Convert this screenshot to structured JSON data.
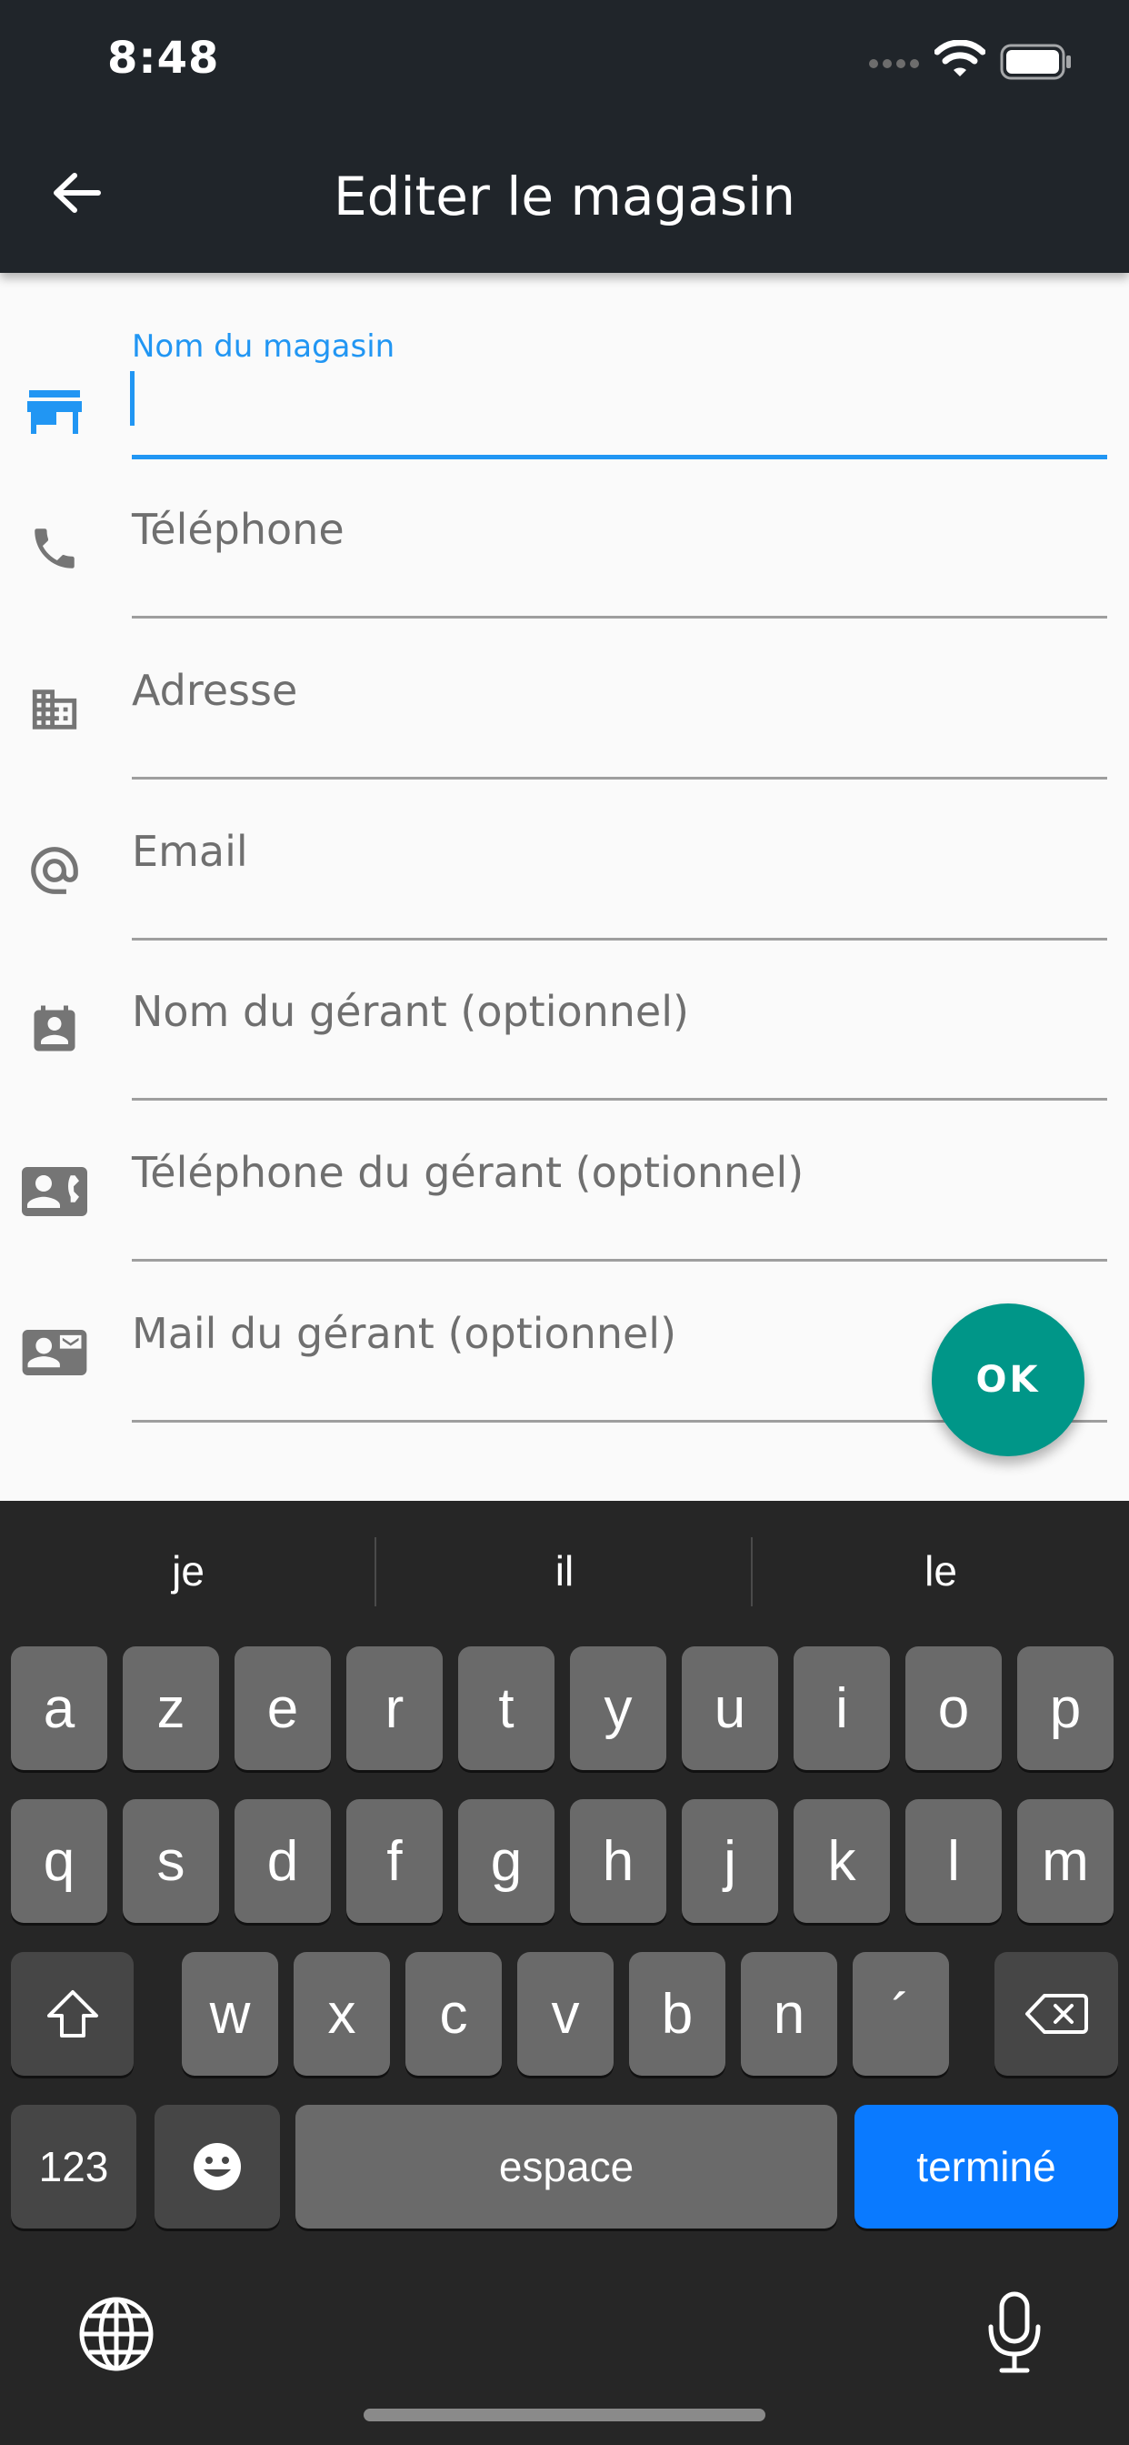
{
  "status_bar": {
    "time": "8:48",
    "signal_icon": "signal-icon",
    "wifi_icon": "wifi-icon",
    "battery_icon": "battery-icon"
  },
  "app_bar": {
    "title": "Editer le magasin",
    "back_icon": "arrow-back-icon"
  },
  "form": {
    "fields": [
      {
        "label": "Nom du magasin",
        "value": "",
        "icon": "store-icon",
        "focused": true
      },
      {
        "label": "Téléphone",
        "icon": "phone-icon"
      },
      {
        "label": "Adresse",
        "icon": "business-icon"
      },
      {
        "label": "Email",
        "icon": "at-sign-icon"
      },
      {
        "label": "Nom du gérant (optionnel)",
        "icon": "contact-calendar-icon"
      },
      {
        "label": "Téléphone du gérant (optionnel)",
        "icon": "contact-phone-icon"
      },
      {
        "label": "Mail du gérant (optionnel)",
        "icon": "contact-mail-icon"
      }
    ],
    "ok_label": "OK"
  },
  "keyboard": {
    "suggestions": [
      "je",
      "il",
      "le"
    ],
    "rows": [
      [
        "a",
        "z",
        "e",
        "r",
        "t",
        "y",
        "u",
        "i",
        "o",
        "p"
      ],
      [
        "q",
        "s",
        "d",
        "f",
        "g",
        "h",
        "j",
        "k",
        "l",
        "m"
      ],
      [
        "w",
        "x",
        "c",
        "v",
        "b",
        "n",
        "´"
      ]
    ],
    "numbers_label": "123",
    "space_label": "espace",
    "done_label": "terminé"
  },
  "colors": {
    "app_bar": "#20252a",
    "accent": "#2196f3",
    "fab": "#009688",
    "keyboard_bg": "#262626",
    "done_key": "#0a7aff"
  }
}
